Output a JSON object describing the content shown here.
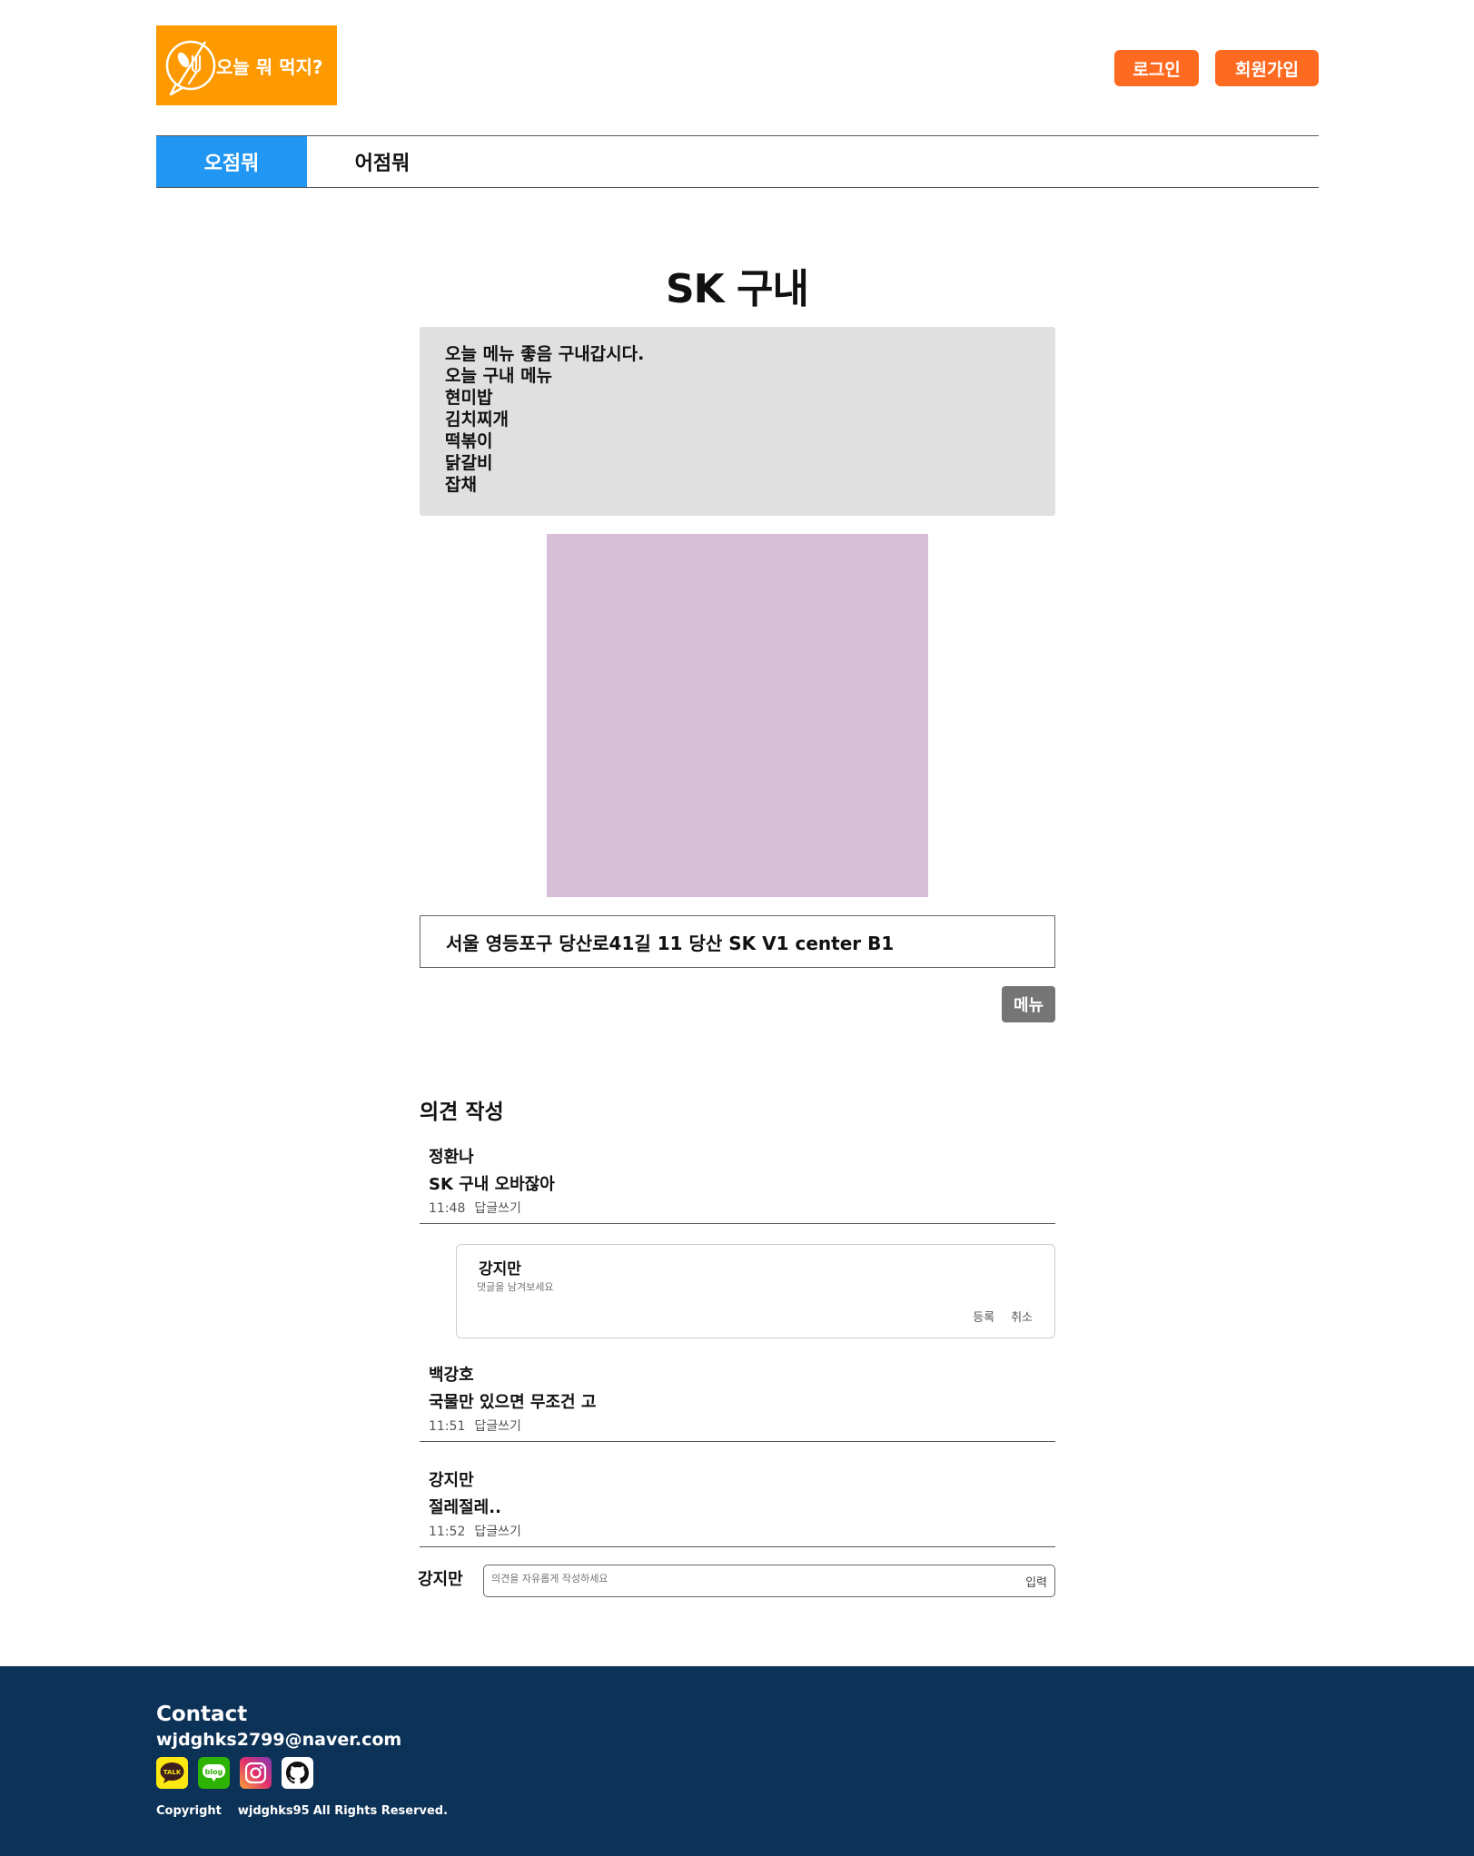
{
  "header": {
    "logo_text": "오늘 뭐 먹지?",
    "login_label": "로그인",
    "signup_label": "회원가입"
  },
  "tabs": [
    {
      "label": "오점뭐",
      "active": true
    },
    {
      "label": "어점뭐",
      "active": false
    }
  ],
  "post": {
    "title": "SK 구내",
    "description_lines": [
      "오늘 메뉴 좋음 구내갑시다.",
      "오늘 구내 메뉴",
      "현미밥",
      "김치찌개",
      "떡볶이",
      "닭갈비",
      "잡채"
    ],
    "address": "서울 영등포구 당산로41길 11 당산 SK V1 center B1",
    "menu_button": "메뉴"
  },
  "comments_section": {
    "title": "의견 작성",
    "comments": [
      {
        "author": "정환나",
        "text": "SK 구내 오바잖아",
        "time": "11:48",
        "reply_label": "답글쓰기"
      },
      {
        "author": "백강호",
        "text": "국물만 있으면 무조건 고",
        "time": "11:51",
        "reply_label": "답글쓰기"
      },
      {
        "author": "강지만",
        "text": "절레절레..",
        "time": "11:52",
        "reply_label": "답글쓰기"
      }
    ],
    "reply_form": {
      "author": "강지만",
      "placeholder": "댓글을 남겨보세요",
      "submit_label": "등록",
      "cancel_label": "취소"
    },
    "write_form": {
      "author": "강지만",
      "placeholder": "의견을 자유롭게 작성하세요",
      "submit_label": "입력"
    }
  },
  "footer": {
    "contact_title": "Contact",
    "email": "wjdghks2799@naver.com",
    "icons": [
      "kakaotalk-icon",
      "blog-icon",
      "instagram-icon",
      "github-icon"
    ],
    "copyright_prefix": "Copyright",
    "copyright_user": "wjdghks95",
    "copyright_suffix": "All Rights Reserved."
  },
  "colors": {
    "logo_bg": "#FF9900",
    "auth_button": "#FF6A21",
    "active_tab": "#2196F3",
    "description_bg": "#e0e0e0",
    "image_placeholder": "#d8bfd8",
    "menu_button": "#757575",
    "footer_bg": "#0D3257"
  }
}
